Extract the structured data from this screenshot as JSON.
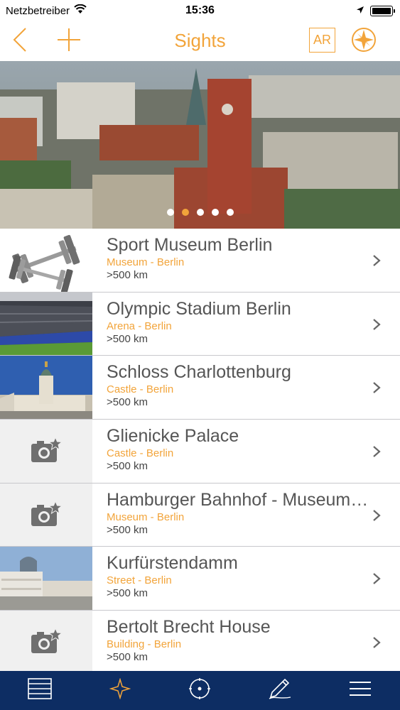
{
  "status_bar": {
    "carrier": "Netzbetreiber",
    "time": "15:36",
    "icons": [
      "wifi-icon",
      "location-arrow-icon",
      "battery-icon"
    ]
  },
  "nav": {
    "title": "Sights",
    "back_icon": "back-chevron-icon",
    "add_icon": "plus-icon",
    "ar_label": "AR",
    "compass_icon": "compass-icon",
    "accent_color": "#f2a43a"
  },
  "hero": {
    "page_count": 5,
    "active_page": 1
  },
  "sights": [
    {
      "title": "Sport Museum Berlin",
      "subtitle": "Museum - Berlin",
      "distance": ">500 km",
      "thumb": "dumbbells"
    },
    {
      "title": "Olympic Stadium Berlin",
      "subtitle": "Arena - Berlin",
      "distance": ">500 km",
      "thumb": "stadium"
    },
    {
      "title": "Schloss Charlottenburg",
      "subtitle": "Castle - Berlin",
      "distance": ">500 km",
      "thumb": "palace"
    },
    {
      "title": "Glienicke Palace",
      "subtitle": "Castle - Berlin",
      "distance": ">500 km",
      "thumb": "placeholder-camera-icon"
    },
    {
      "title": "Hamburger Bahnhof - Museum für Gegenwart",
      "subtitle": "Museum - Berlin",
      "distance": ">500 km",
      "thumb": "placeholder-camera-icon"
    },
    {
      "title": "Kurfürstendamm",
      "subtitle": "Street - Berlin",
      "distance": ">500 km",
      "thumb": "street"
    },
    {
      "title": "Bertolt Brecht House",
      "subtitle": "Building - Berlin",
      "distance": ">500 km",
      "thumb": "placeholder-camera-icon"
    }
  ],
  "tab_bar": {
    "background": "#0d2d63",
    "tabs": [
      "list-icon",
      "star-icon",
      "location-target-icon",
      "pencil-icon",
      "menu-icon"
    ],
    "active_tab": 1
  }
}
